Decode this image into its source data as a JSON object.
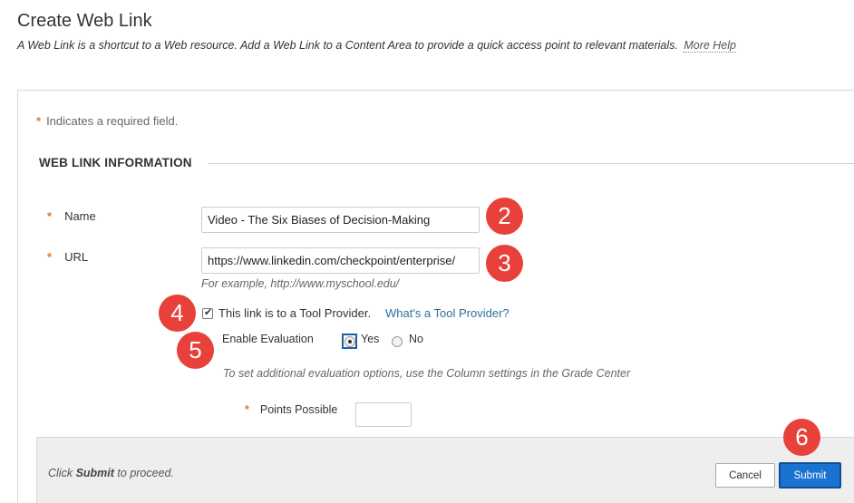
{
  "page": {
    "title": "Create Web Link",
    "description": "A Web Link is a shortcut to a Web resource. Add a Web Link to a Content Area to provide a quick access point to relevant materials.",
    "more_help": "More Help"
  },
  "required_note": {
    "star": "*",
    "text": "Indicates a required field."
  },
  "section": {
    "title": "WEB LINK INFORMATION"
  },
  "fields": {
    "name": {
      "label": "Name",
      "value": "Video - The Six Biases of Decision-Making"
    },
    "url": {
      "label": "URL",
      "value": "https://www.linkedin.com/checkpoint/enterprise/",
      "hint": "For example, http://www.myschool.edu/"
    }
  },
  "tool_provider": {
    "checked": true,
    "label": "This link is to a Tool Provider.",
    "help_link": "What's a Tool Provider?"
  },
  "evaluation": {
    "label": "Enable Evaluation",
    "options": [
      "Yes",
      "No"
    ],
    "selected": "Yes",
    "note": "To set additional evaluation options, use the Column settings in the Grade Center"
  },
  "points": {
    "label": "Points Possible",
    "value": ""
  },
  "callouts": [
    "2",
    "3",
    "4",
    "5",
    "6"
  ],
  "footer": {
    "prefix": "Click",
    "bold": "Submit",
    "suffix": "to proceed.",
    "cancel_label": "Cancel",
    "submit_label": "Submit"
  },
  "colors": {
    "required_star": "#e87722",
    "link": "#2b6f9e",
    "callout": "#e8413b",
    "submit": "#1a73d0"
  }
}
